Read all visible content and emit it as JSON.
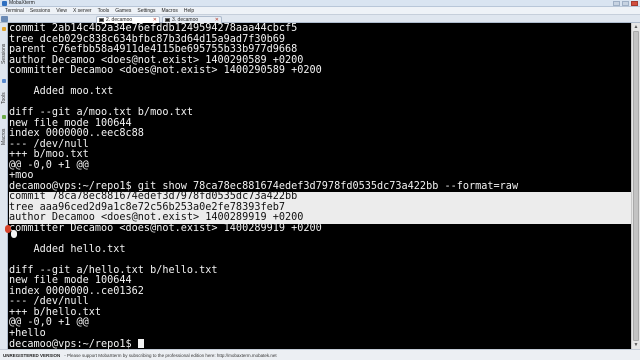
{
  "window": {
    "title": "MobaXterm"
  },
  "menubar": {
    "items": [
      "Terminal",
      "Sessions",
      "View",
      "X server",
      "Tools",
      "Games",
      "Settings",
      "Macros",
      "Help"
    ]
  },
  "tabs": [
    {
      "label": "2. decamoo",
      "active": true
    },
    {
      "label": "3. decamoo",
      "active": false
    }
  ],
  "sidebar": {
    "tabs": [
      "Sessions",
      "Tools",
      "Macros"
    ]
  },
  "terminal": {
    "lines": [
      {
        "text": "commit 2ab14c4b2a34e76efddb1249594278aaa44cbcf5",
        "highlight": false
      },
      {
        "text": "tree dceb029c838c634bfbc87b3d64d15a9ad7f30b69",
        "highlight": false
      },
      {
        "text": "parent c76efbb58a4911de4115be695755b33b977d9668",
        "highlight": false
      },
      {
        "text": "author Decamoo <does@not.exist> 1400290589 +0200",
        "highlight": false
      },
      {
        "text": "committer Decamoo <does@not.exist> 1400290589 +0200",
        "highlight": false
      },
      {
        "text": "",
        "highlight": false
      },
      {
        "text": "    Added moo.txt",
        "highlight": false
      },
      {
        "text": "",
        "highlight": false
      },
      {
        "text": "diff --git a/moo.txt b/moo.txt",
        "highlight": false
      },
      {
        "text": "new file mode 100644",
        "highlight": false
      },
      {
        "text": "index 0000000..eec8c88",
        "highlight": false
      },
      {
        "text": "--- /dev/null",
        "highlight": false
      },
      {
        "text": "+++ b/moo.txt",
        "highlight": false
      },
      {
        "text": "@@ -0,0 +1 @@",
        "highlight": false
      },
      {
        "text": "+moo",
        "highlight": false
      },
      {
        "text": "decamoo@vps:~/repo1$ git show 78ca78ec881674edef3d7978fd0535dc73a422bb --format=raw",
        "highlight": false
      },
      {
        "text": "commit 78ca78ec881674edef3d7978fd0535dc73a422bb",
        "highlight": true
      },
      {
        "text": "tree aaa96ced2d9a1c8e72c56b253a0e2fe78393feb7",
        "highlight": true
      },
      {
        "text": "author Decamoo <does@not.exist> 1400289919 +0200",
        "highlight": true
      },
      {
        "text": "committer Decamoo <does@not.exist> 1400289919 +0200",
        "highlight": false
      },
      {
        "text": "",
        "highlight": false
      },
      {
        "text": "    Added hello.txt",
        "highlight": false
      },
      {
        "text": "",
        "highlight": false
      },
      {
        "text": "diff --git a/hello.txt b/hello.txt",
        "highlight": false
      },
      {
        "text": "new file mode 100644",
        "highlight": false
      },
      {
        "text": "index 0000000..ce01362",
        "highlight": false
      },
      {
        "text": "--- /dev/null",
        "highlight": false
      },
      {
        "text": "+++ b/hello.txt",
        "highlight": false
      },
      {
        "text": "@@ -0,0 +1 @@",
        "highlight": false
      },
      {
        "text": "+hello",
        "highlight": false
      }
    ],
    "prompt": "decamoo@vps:~/repo1$ "
  },
  "statusbar": {
    "bold": "UNREGISTERED VERSION",
    "text": "-  Please support MobaXterm by subscribing to the professional edition here:  http://mobaxterm.mobatek.net"
  },
  "colors": {
    "terminal_bg": "#000000",
    "terminal_fg": "#f2f2f2",
    "selection_bg": "#ececec",
    "red_marker": "#d8442b"
  },
  "icons": {
    "logo": "mobaxterm-logo-icon",
    "tab_terminal": "terminal-icon",
    "tab_close": "close-icon"
  }
}
